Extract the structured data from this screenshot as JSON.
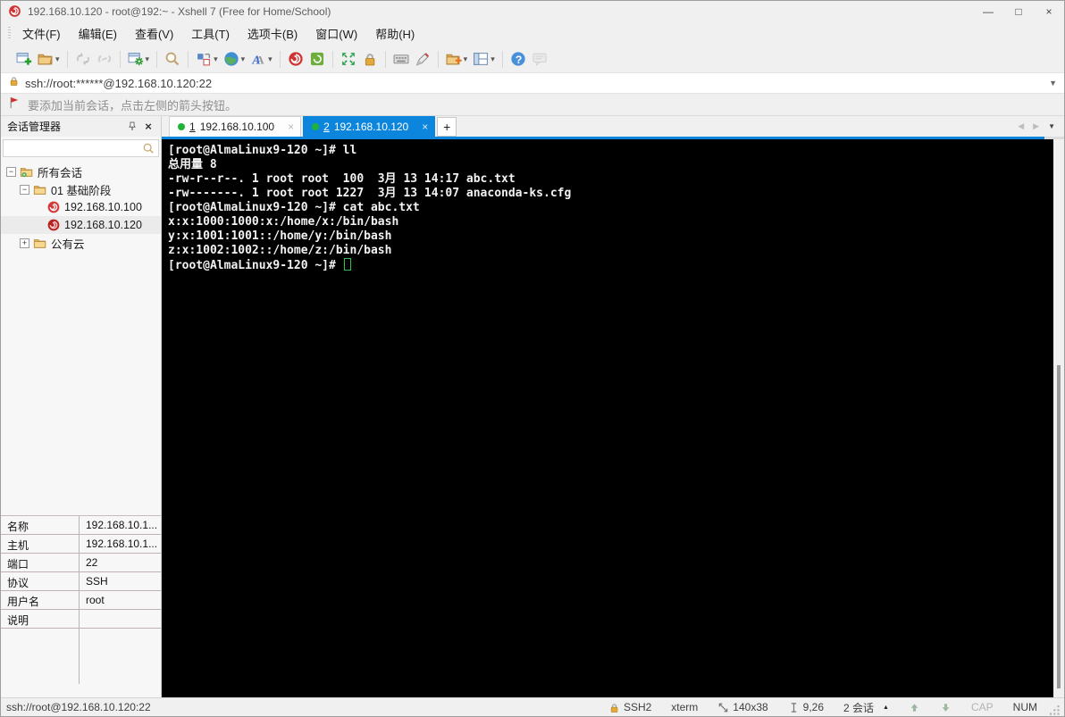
{
  "window": {
    "title": "192.168.10.120 - root@192:~ - Xshell 7 (Free for Home/School)",
    "controls": {
      "minimize": "—",
      "maximize": "□",
      "close": "×"
    }
  },
  "menubar": {
    "items": [
      "文件(F)",
      "编辑(E)",
      "查看(V)",
      "工具(T)",
      "选项卡(B)",
      "窗口(W)",
      "帮助(H)"
    ]
  },
  "toolbar": {
    "buttons": [
      {
        "icon": "new-session",
        "dropdown": false,
        "disabled": false,
        "sep": false
      },
      {
        "icon": "open-folder",
        "dropdown": true,
        "disabled": false,
        "sep": false
      },
      {
        "icon": "disconnect",
        "dropdown": false,
        "disabled": true,
        "sep": true
      },
      {
        "icon": "reconnect",
        "dropdown": false,
        "disabled": true,
        "sep": false
      },
      {
        "icon": "session-properties",
        "dropdown": true,
        "disabled": false,
        "sep": true
      },
      {
        "icon": "find",
        "dropdown": false,
        "disabled": false,
        "sep": true
      },
      {
        "icon": "arrange",
        "dropdown": true,
        "disabled": false,
        "sep": true
      },
      {
        "icon": "globe",
        "dropdown": true,
        "disabled": false,
        "sep": false
      },
      {
        "icon": "font",
        "dropdown": true,
        "disabled": false,
        "sep": false
      },
      {
        "icon": "xshell",
        "dropdown": false,
        "disabled": false,
        "sep": true
      },
      {
        "icon": "xftp",
        "dropdown": false,
        "disabled": false,
        "sep": false
      },
      {
        "icon": "fullscreen",
        "dropdown": false,
        "disabled": false,
        "sep": true
      },
      {
        "icon": "lock",
        "dropdown": false,
        "disabled": false,
        "sep": false
      },
      {
        "icon": "keyboard",
        "dropdown": false,
        "disabled": false,
        "sep": true
      },
      {
        "icon": "pen",
        "dropdown": false,
        "disabled": false,
        "sep": false
      },
      {
        "icon": "folder-plus",
        "dropdown": true,
        "disabled": false,
        "sep": true
      },
      {
        "icon": "layout",
        "dropdown": true,
        "disabled": false,
        "sep": false
      },
      {
        "icon": "help",
        "dropdown": false,
        "disabled": false,
        "sep": true
      },
      {
        "icon": "message",
        "dropdown": false,
        "disabled": true,
        "sep": false
      }
    ]
  },
  "addressbar": {
    "value": "ssh://root:******@192.168.10.120:22"
  },
  "infobar": {
    "text": "要添加当前会话，点击左侧的箭头按钮。"
  },
  "session_manager": {
    "title": "会话管理器",
    "search_value": "",
    "tree": [
      {
        "label": "所有会话",
        "depth": 0,
        "icon": "folder-root",
        "toggle": "minus",
        "selected": false
      },
      {
        "label": "01 基础阶段",
        "depth": 1,
        "icon": "folder",
        "toggle": "minus",
        "selected": false
      },
      {
        "label": "192.168.10.100",
        "depth": 2,
        "icon": "session",
        "toggle": "none",
        "selected": false
      },
      {
        "label": "192.168.10.120",
        "depth": 2,
        "icon": "session-active",
        "toggle": "none",
        "selected": true
      },
      {
        "label": "公有云",
        "depth": 1,
        "icon": "folder",
        "toggle": "plus",
        "selected": false
      }
    ]
  },
  "properties": {
    "rows": [
      {
        "label": "名称",
        "value": "192.168.10.1..."
      },
      {
        "label": "主机",
        "value": "192.168.10.1..."
      },
      {
        "label": "端口",
        "value": "22"
      },
      {
        "label": "协议",
        "value": "SSH"
      },
      {
        "label": "用户名",
        "value": "root"
      },
      {
        "label": "说明",
        "value": ""
      }
    ]
  },
  "tabs": {
    "items": [
      {
        "number": "1",
        "label": "192.168.10.100",
        "active": false,
        "close": "×"
      },
      {
        "number": "2",
        "label": "192.168.10.120",
        "active": true,
        "close": "×"
      }
    ],
    "add_label": "+",
    "nav": {
      "prev": "◀",
      "next": "▶",
      "menu": "▼"
    }
  },
  "terminal": {
    "lines": [
      {
        "text": "[root@AlmaLinux9-120 ~]# ll"
      },
      {
        "text": "总用量 8"
      },
      {
        "text": "-rw-r--r--. 1 root root  100  3月 13 14:17 abc.txt"
      },
      {
        "text": "-rw-------. 1 root root 1227  3月 13 14:07 anaconda-ks.cfg"
      },
      {
        "text": "[root@AlmaLinux9-120 ~]# cat abc.txt"
      },
      {
        "text": "x:x:1000:1000:x:/home/x:/bin/bash"
      },
      {
        "text": "y:x:1001:1001::/home/y:/bin/bash"
      },
      {
        "text": "z:x:1002:1002::/home/z:/bin/bash"
      },
      {
        "text": "[root@AlmaLinux9-120 ~]# ",
        "cursor": true
      }
    ]
  },
  "statusbar": {
    "left": "ssh://root@192.168.10.120:22",
    "items": [
      {
        "name": "encryption",
        "icon": "lock-small",
        "label": "SSH2",
        "dim": false,
        "caret": "",
        "interactable": false
      },
      {
        "name": "terminal-type",
        "icon": "",
        "label": "xterm",
        "dim": false,
        "caret": "",
        "interactable": false
      },
      {
        "name": "terminal-size",
        "icon": "resize",
        "label": "140x38",
        "dim": false,
        "caret": "",
        "interactable": false
      },
      {
        "name": "cursor-position",
        "icon": "caret-pos",
        "label": "9,26",
        "dim": false,
        "caret": "",
        "interactable": false
      },
      {
        "name": "session-count",
        "icon": "",
        "label": "2 会话",
        "dim": false,
        "caret": "▲",
        "interactable": true
      },
      {
        "name": "scroll-up",
        "icon": "arrow-up",
        "label": "",
        "dim": false,
        "caret": "",
        "interactable": true
      },
      {
        "name": "scroll-down",
        "icon": "arrow-down",
        "label": "",
        "dim": false,
        "caret": "",
        "interactable": true
      },
      {
        "name": "caps-lock",
        "icon": "",
        "label": "CAP",
        "dim": true,
        "caret": "",
        "interactable": false
      },
      {
        "name": "num-lock",
        "icon": "",
        "label": "NUM",
        "dim": false,
        "caret": "",
        "interactable": false
      }
    ]
  }
}
